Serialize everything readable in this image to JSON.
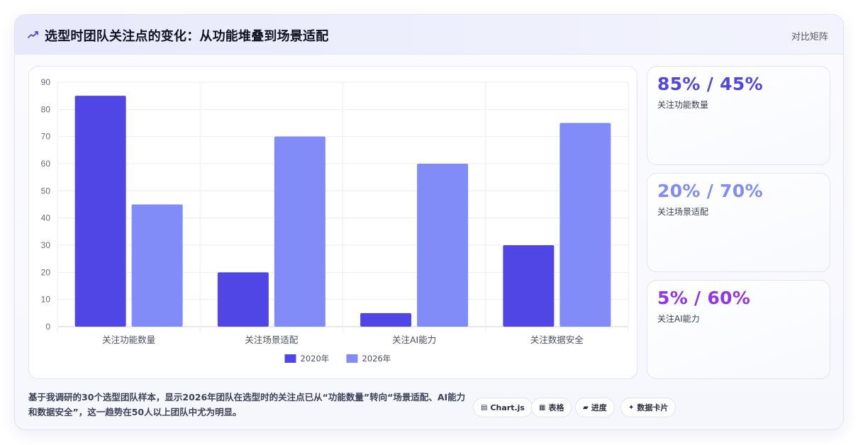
{
  "header": {
    "icon": "trend-line-icon",
    "title": "选型时团队关注点的变化：从功能堆叠到场景适配",
    "link_label": "对比矩阵"
  },
  "chart_data": {
    "type": "bar",
    "categories": [
      "关注功能数量",
      "关注场景适配",
      "关注AI能力",
      "关注数据安全"
    ],
    "series": [
      {
        "name": "2020年",
        "values": [
          85,
          20,
          5,
          30
        ],
        "color": "#4f46e5"
      },
      {
        "name": "2026年",
        "values": [
          45,
          70,
          60,
          75
        ],
        "color": "#818cf8"
      }
    ],
    "ylim": [
      0,
      90
    ],
    "yticks": [
      0,
      10,
      20,
      30,
      40,
      50,
      60,
      70,
      80,
      90
    ],
    "title": "",
    "xlabel": "",
    "ylabel": "",
    "grid": true,
    "legend": "bottom"
  },
  "stats": [
    {
      "value": "85% / 45%",
      "label": "关注功能数量",
      "color": "#4f46e5"
    },
    {
      "value": "20% / 70%",
      "label": "关注场景适配",
      "color": "#818cf8"
    },
    {
      "value": "5% / 60%",
      "label": "关注AI能力",
      "color": "#9333ea"
    }
  ],
  "footer": {
    "text": "基于我调研的30个选型团队样本，显示2026年团队在选型时的关注点已从“功能数量”转向“场景适配、AI能力和数据安全”，这一趋势在50人以上团队中尤为明显。"
  },
  "chips": [
    {
      "icon": "chart-icon",
      "glyph": "▤",
      "label": "Chart.js"
    },
    {
      "icon": "table-icon",
      "glyph": "▦",
      "label": "表格"
    },
    {
      "icon": "progress-icon",
      "glyph": "▰",
      "label": "进度"
    },
    {
      "icon": "sparkle-icon",
      "glyph": "✦",
      "label": "数据卡片"
    }
  ]
}
